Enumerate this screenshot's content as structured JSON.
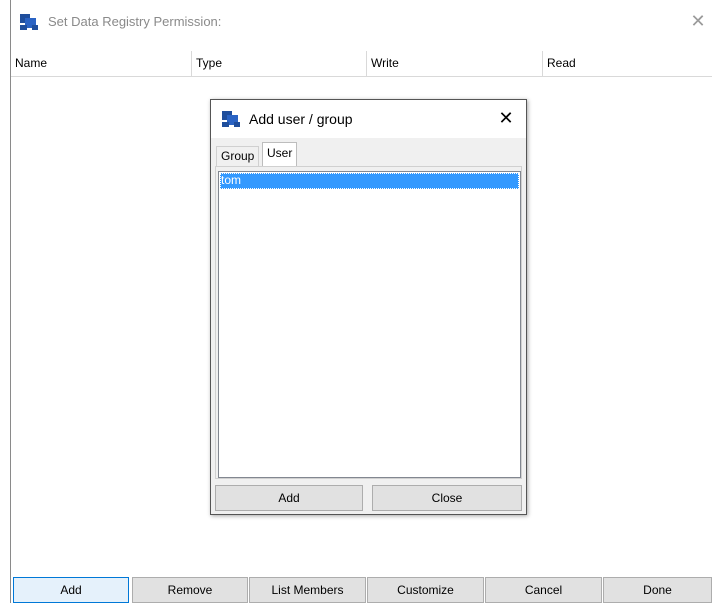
{
  "main_window": {
    "title": "Set Data Registry Permission:",
    "close_glyph": "✕",
    "columns": [
      "Name",
      "Type",
      "Write",
      "Read"
    ],
    "buttons": {
      "add": "Add",
      "remove": "Remove",
      "list_members": "List Members",
      "customize": "Customize",
      "cancel": "Cancel",
      "done": "Done"
    },
    "icon": "app-icon"
  },
  "dialog": {
    "title": "Add user / group",
    "close_glyph": "✕",
    "tabs": [
      "Group",
      "User"
    ],
    "active_tab": "User",
    "users": [
      "tom"
    ],
    "selected_user": "tom",
    "buttons": {
      "add": "Add",
      "close": "Close"
    }
  },
  "colors": {
    "selection": "#3399ff",
    "default_button_border": "#0078d7",
    "icon_blue": "#1f4e9c"
  }
}
